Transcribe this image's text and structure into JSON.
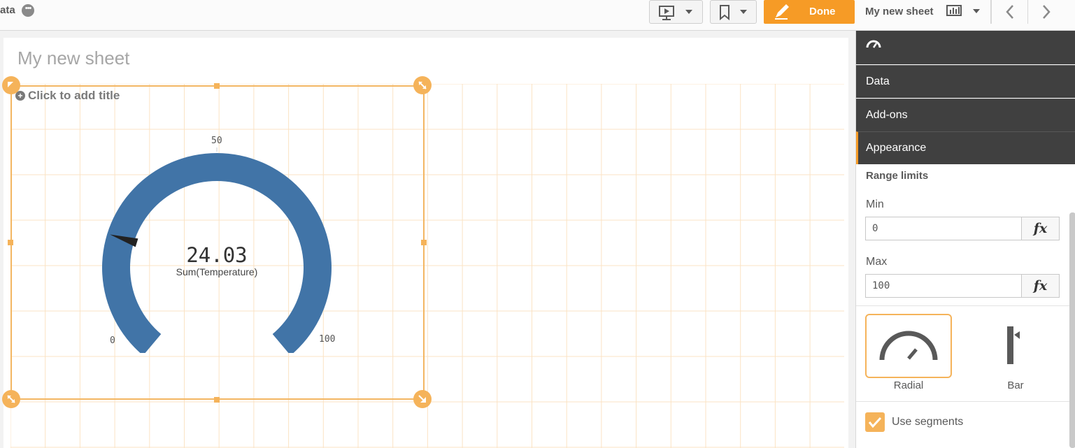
{
  "toolbar": {
    "app_name": "ata",
    "done_label": "Done",
    "sheet_name": "My new sheet"
  },
  "canvas": {
    "sheet_title": "My new sheet",
    "add_title_prompt": "Click to add title"
  },
  "gauge": {
    "value_text": "24.03",
    "measure_label": "Sum(Temperature)",
    "value": 24.03,
    "min": 0,
    "max": 100,
    "tick_min": "0",
    "tick_mid": "50",
    "tick_max": "100",
    "color": "#4174a7"
  },
  "panel": {
    "header_icon": "gauge-icon",
    "sections": [
      "Data",
      "Add-ons",
      "Appearance"
    ],
    "range_title": "Range limits",
    "min_label": "Min",
    "min_value": "0",
    "max_label": "Max",
    "max_value": "100",
    "fx_label": "fx",
    "style_radial": "Radial",
    "style_bar": "Bar",
    "use_segments": "Use segments"
  },
  "colors": {
    "accent": "#f69b26",
    "handle": "#f5b35a",
    "panel_dark": "#404040"
  }
}
